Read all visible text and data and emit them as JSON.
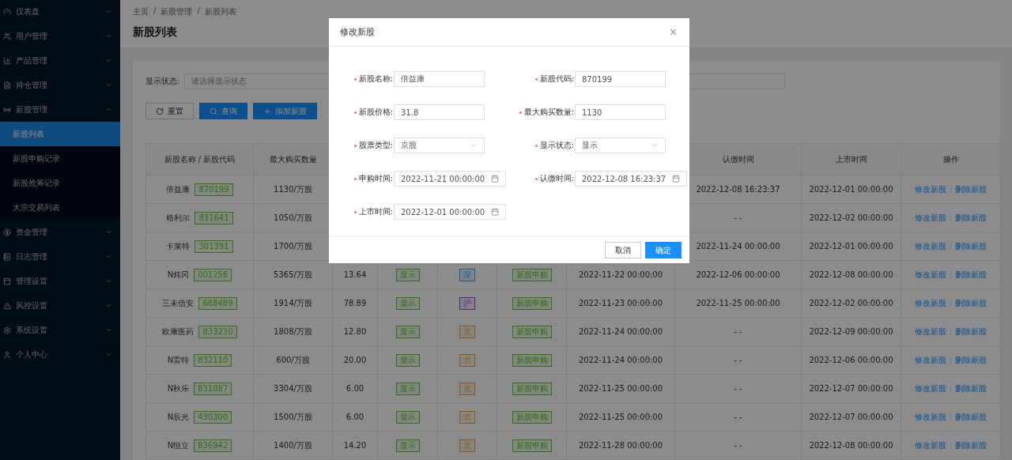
{
  "sidebar": {
    "items": [
      {
        "label": "仪表盘",
        "expanded": false
      },
      {
        "label": "用户管理",
        "expanded": false
      },
      {
        "label": "产品管理",
        "expanded": false
      },
      {
        "label": "持仓管理",
        "expanded": false
      },
      {
        "label": "新股管理",
        "expanded": true,
        "children": [
          {
            "label": "新股列表",
            "selected": true
          },
          {
            "label": "新股申购记录",
            "selected": false
          },
          {
            "label": "新股抢筹记录",
            "selected": false
          },
          {
            "label": "大宗交易列表",
            "selected": false
          }
        ]
      },
      {
        "label": "资金管理",
        "expanded": false
      },
      {
        "label": "日志管理",
        "expanded": false
      },
      {
        "label": "管理设置",
        "expanded": false
      },
      {
        "label": "风控设置",
        "expanded": false
      },
      {
        "label": "系统设置",
        "expanded": false
      },
      {
        "label": "个人中心",
        "expanded": false
      }
    ]
  },
  "breadcrumb": {
    "separator": "/",
    "items": [
      "主页",
      "新股管理",
      "新股列表"
    ]
  },
  "page_title": "新股列表",
  "filter": {
    "label": "显示状态:",
    "placeholder": "请选择显示状态"
  },
  "toolbar": [
    {
      "label": "重置",
      "kind": "reset"
    },
    {
      "label": "查询",
      "kind": "search"
    },
    {
      "label": "添加新股",
      "kind": "add"
    }
  ],
  "table": {
    "columns": [
      "新股名称 / 新股代码",
      "最大购买数量",
      null,
      null,
      null,
      null,
      null,
      "认缴时间",
      "上市时间",
      "操作"
    ],
    "rows": [
      {
        "name": "倍益康",
        "code": "870199",
        "max_qty": "1130/万股",
        "pay_time": "2022-12-08 16:23:37",
        "list_time": "2022-12-01 00:00:00",
        "actions": [
          "修改新股",
          "删除新股"
        ]
      },
      {
        "name": "格利尔",
        "code": "831641",
        "max_qty": "1050/万股",
        "pay_time": "- -",
        "list_time": "2022-12-02 00:00:00",
        "actions": [
          "修改新股",
          "删除新股"
        ]
      },
      {
        "name": "卡莱特",
        "code": "301391",
        "max_qty": "1700/万股",
        "pay_time": "2022-11-24 00:00:00",
        "list_time": "2022-12-01 00:00:00",
        "actions": [
          "修改新股",
          "删除新股"
        ]
      },
      {
        "name": "N炜冈",
        "code": "001256",
        "max_qty": "5365/万股",
        "price": "13.64",
        "display": "显示",
        "market": {
          "label": "深",
          "color": "#23578c"
        },
        "phase": "新股申购",
        "subscribe_time": "2022-11-22 00:00:00",
        "pay_time": "2022-12-06 00:00:00",
        "list_time": "2022-12-08 00:00:00",
        "actions": [
          "修改新股",
          "删除新股"
        ]
      },
      {
        "name": "三未信安",
        "code": "688489",
        "max_qty": "1914/万股",
        "price": "78.89",
        "display": "显示",
        "market": {
          "label": "沪",
          "color": "#502e7a"
        },
        "phase": "新股申购",
        "subscribe_time": "2022-11-23 00:00:00",
        "pay_time": "2022-11-25 00:00:00",
        "list_time": "2022-12-02 00:00:00",
        "actions": [
          "修改新股",
          "删除新股"
        ]
      },
      {
        "name": "欧康医药",
        "code": "833230",
        "max_qty": "1808/万股",
        "price": "12.80",
        "display": "显示",
        "market": {
          "label": "北",
          "color": "#7f5921"
        },
        "phase": "新股申购",
        "subscribe_time": "2022-11-24 00:00:00",
        "pay_time": "- -",
        "list_time": "2022-12-09 00:00:00",
        "actions": [
          "修改新股",
          "删除新股"
        ]
      },
      {
        "name": "N雷特",
        "code": "832110",
        "max_qty": "600/万股",
        "price": "20.00",
        "display": "显示",
        "market": {
          "label": "北",
          "color": "#7f5921"
        },
        "phase": "新股申购",
        "subscribe_time": "2022-11-24 00:00:00",
        "pay_time": "- -",
        "list_time": "2022-12-06 00:00:00",
        "actions": [
          "修改新股",
          "删除新股"
        ]
      },
      {
        "name": "N秋乐",
        "code": "831087",
        "max_qty": "3304/万股",
        "price": "6.00",
        "display": "显示",
        "market": {
          "label": "北",
          "color": "#7f5921"
        },
        "phase": "新股申购",
        "subscribe_time": "2022-11-25 00:00:00",
        "pay_time": "- -",
        "list_time": "2022-12-07 00:00:00",
        "actions": [
          "修改新股",
          "删除新股"
        ]
      },
      {
        "name": "N辰光",
        "code": "430300",
        "max_qty": "1500/万股",
        "price": "6.00",
        "display": "显示",
        "market": {
          "label": "北",
          "color": "#7f5921"
        },
        "phase": "新股申购",
        "subscribe_time": "2022-11-25 00:00:00",
        "pay_time": "- -",
        "list_time": "2022-12-07 00:00:00",
        "actions": [
          "修改新股",
          "删除新股"
        ]
      },
      {
        "name": "N恒立",
        "code": "836942",
        "max_qty": "1400/万股",
        "price": "14.20",
        "display": "显示",
        "market": {
          "label": "北",
          "color": "#7f5921"
        },
        "phase": "新股申购",
        "subscribe_time": "2022-11-28 00:00:00",
        "pay_time": "- -",
        "list_time": "2022-12-08 00:00:00",
        "actions": [
          "修改新股",
          "删除新股"
        ]
      }
    ]
  },
  "dialog": {
    "title": "修改新股",
    "fields": [
      {
        "label": "新股名称:",
        "value": "倍益康",
        "kind": "text",
        "required": true
      },
      {
        "label": "新股代码:",
        "value": "870199",
        "kind": "text",
        "required": true
      },
      {
        "label": "新股价格:",
        "value": "31.8",
        "kind": "text",
        "required": true
      },
      {
        "label": "最大购买数量:",
        "value": "1130",
        "kind": "text",
        "required": true
      },
      {
        "label": "股票类型:",
        "value": "京股",
        "kind": "select",
        "required": true
      },
      {
        "label": "显示状态:",
        "value": "显示",
        "kind": "select",
        "required": true
      },
      {
        "label": "申购时间:",
        "value": "2022-11-21 00:00:00",
        "kind": "date",
        "required": true
      },
      {
        "label": "认缴时间:",
        "value": "2022-12-08 16:23:37",
        "kind": "date",
        "required": true
      },
      {
        "label": "上市时间:",
        "value": "2022-12-01 00:00:00",
        "kind": "date",
        "required": true
      }
    ],
    "buttons": [
      {
        "label": "取消",
        "kind": "default"
      },
      {
        "label": "确定",
        "kind": "primary"
      }
    ]
  }
}
